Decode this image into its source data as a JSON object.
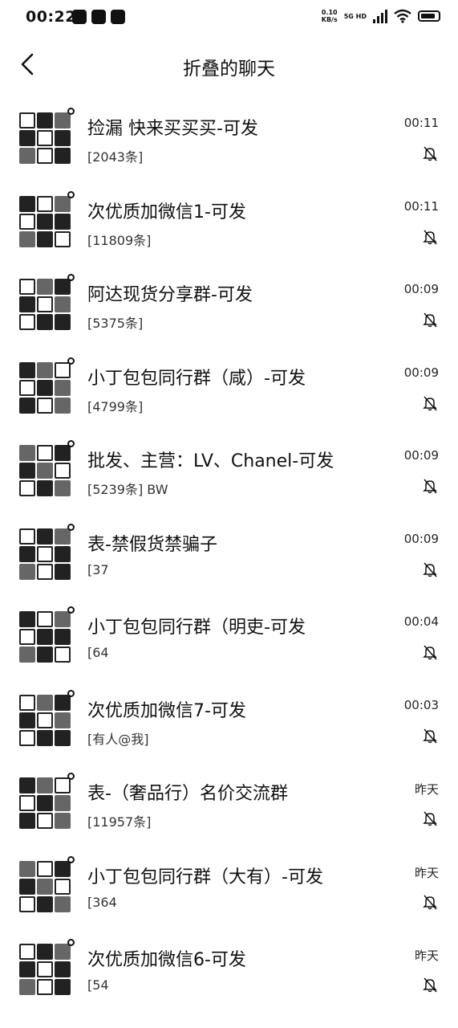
{
  "status": {
    "time": "00:22",
    "net_speed_top": "0.10",
    "net_speed_bottom": "KB/s",
    "network": "5G HD"
  },
  "nav": {
    "title": "折叠的聊天"
  },
  "chats": [
    {
      "name": "捡漏 快来买买买-可发",
      "preview": "[2043条]",
      "time": "00:11"
    },
    {
      "name": "次优质加微信1-可发",
      "preview": "[11809条]",
      "time": "00:11"
    },
    {
      "name": "阿达现货分享群-可发",
      "preview": "[5375条]",
      "time": "00:09"
    },
    {
      "name": "小丁包包同行群（咸）-可发",
      "preview": "[4799条]",
      "time": "00:09"
    },
    {
      "name": "批发、主营：LV、Chanel-可发",
      "preview": "[5239条] BW",
      "time": "00:09"
    },
    {
      "name": "表-禁假货禁骗子",
      "preview": "[37",
      "time": "00:09"
    },
    {
      "name": "小丁包包同行群（明吏-可发",
      "preview": "[64",
      "time": "00:04"
    },
    {
      "name": "次优质加微信7-可发",
      "preview": "[有人@我]",
      "time": "00:03"
    },
    {
      "name": "表-（奢品行）名价交流群",
      "preview": "[11957条]",
      "time": "昨天"
    },
    {
      "name": "小丁包包同行群（大有）-可发",
      "preview": "[364",
      "time": "昨天"
    },
    {
      "name": "次优质加微信6-可发",
      "preview": "[54",
      "time": "昨天"
    }
  ]
}
